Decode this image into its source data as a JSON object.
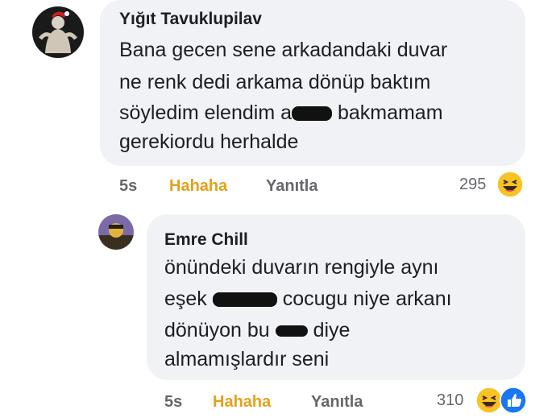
{
  "comments": [
    {
      "author": "Yığıt Tavuklupilav",
      "lines": [
        "Bana gecen sene arkadandaki duvar",
        "ne renk dedi arkama dönüp baktım",
        "söyledim elendim a",
        " bakmamam",
        "gerekiordu herhalde"
      ],
      "time": "5s",
      "reaction_label": "Hahaha",
      "reply_label": "Yanıtla",
      "reaction_count": "295",
      "reaction_icons": [
        "laughing-emoji-icon"
      ],
      "colors": {
        "reaction": "#e4a11b",
        "meta": "#65676b",
        "bubble": "#f0f2f5"
      }
    },
    {
      "author": "Emre Chill",
      "lines": [
        "önündeki duvarın rengiyle aynı",
        "eşek ",
        " cocugu niye arkanı",
        "dönüyon bu ",
        " diye",
        "almamışlardır seni"
      ],
      "time": "5s",
      "reaction_label": "Hahaha",
      "reply_label": "Yanıtla",
      "reaction_count": "310",
      "reaction_icons": [
        "laughing-emoji-icon",
        "like-icon"
      ]
    }
  ]
}
